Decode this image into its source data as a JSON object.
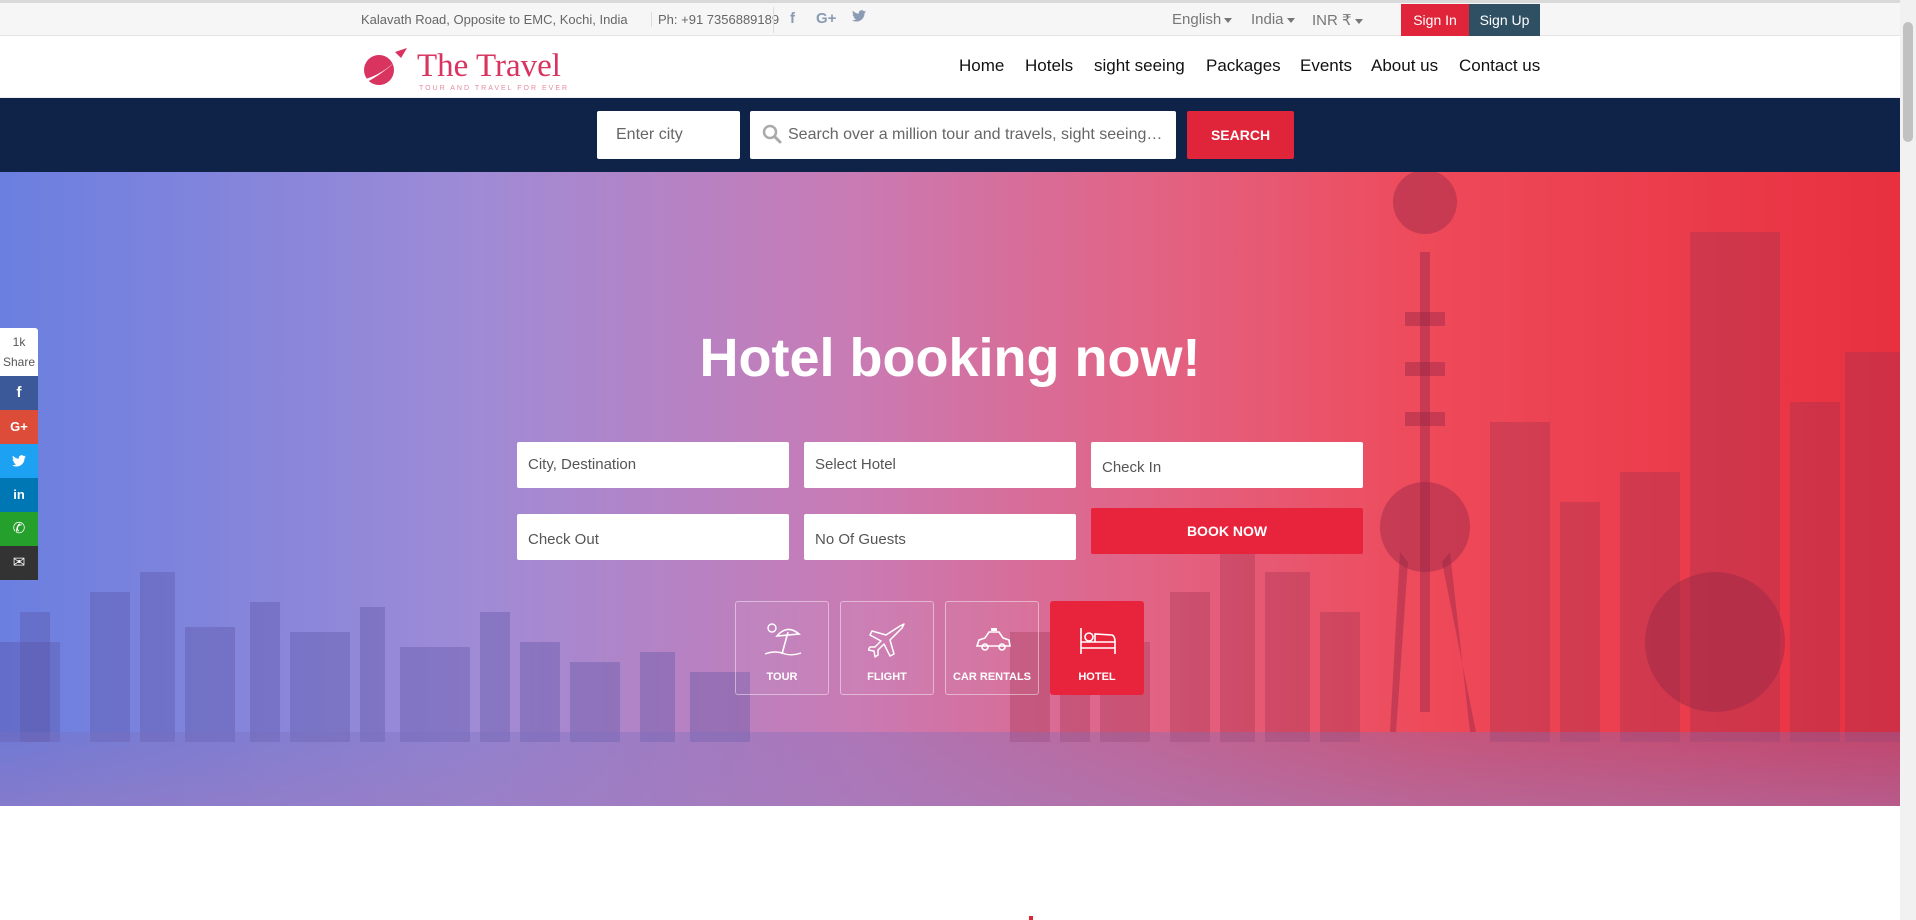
{
  "topbar": {
    "address": "Kalavath Road, Opposite to EMC, Kochi, India",
    "phone": "Ph: +91 7356889189",
    "social": [
      {
        "icon": "facebook-icon",
        "glyph": "f"
      },
      {
        "icon": "google-plus-icon",
        "glyph": "G+"
      },
      {
        "icon": "twitter-icon",
        "glyph": "t"
      }
    ],
    "language": "English",
    "country": "India",
    "currency": "INR ₹",
    "sign_in": "Sign In",
    "sign_up": "Sign Up"
  },
  "header": {
    "brand": "The Travel",
    "tagline": "TOUR AND TRAVEL FOR EVER",
    "nav": [
      "Home",
      "Hotels",
      "sight seeing",
      "Packages",
      "Events",
      "About us",
      "Contact us"
    ]
  },
  "search": {
    "city_placeholder": "Enter city",
    "query_placeholder": "Search over a million tour and travels, sight seeings, hotels and more",
    "button": "SEARCH"
  },
  "hero": {
    "title": "Hotel booking now!",
    "fields": {
      "destination": "City, Destination",
      "hotel": "Select Hotel",
      "check_in": "Check In",
      "check_out": "Check Out",
      "guests": "No Of Guests"
    },
    "book_button": "BOOK NOW",
    "tiles": [
      {
        "label": "TOUR",
        "icon": "beach-umbrella-icon",
        "active": false
      },
      {
        "label": "FLIGHT",
        "icon": "airplane-icon",
        "active": false
      },
      {
        "label": "CAR RENTALS",
        "icon": "car-icon",
        "active": false
      },
      {
        "label": "HOTEL",
        "icon": "bed-icon",
        "active": true
      }
    ]
  },
  "share": {
    "count": "1k",
    "label": "Share",
    "buttons": [
      {
        "icon": "facebook-icon",
        "glyph": "f",
        "color": "#3b5998"
      },
      {
        "icon": "google-plus-icon",
        "glyph": "G+",
        "color": "#dd4b39"
      },
      {
        "icon": "twitter-icon",
        "glyph": "t",
        "color": "#1da1f2"
      },
      {
        "icon": "linkedin-icon",
        "glyph": "in",
        "color": "#0077b5"
      },
      {
        "icon": "whatsapp-icon",
        "glyph": "✆",
        "color": "#25a02c"
      },
      {
        "icon": "email-icon",
        "glyph": "✉",
        "color": "#333333"
      }
    ]
  },
  "colors": {
    "accent": "#e0253a",
    "navy": "#0e2347",
    "signup": "#2f4f63"
  }
}
